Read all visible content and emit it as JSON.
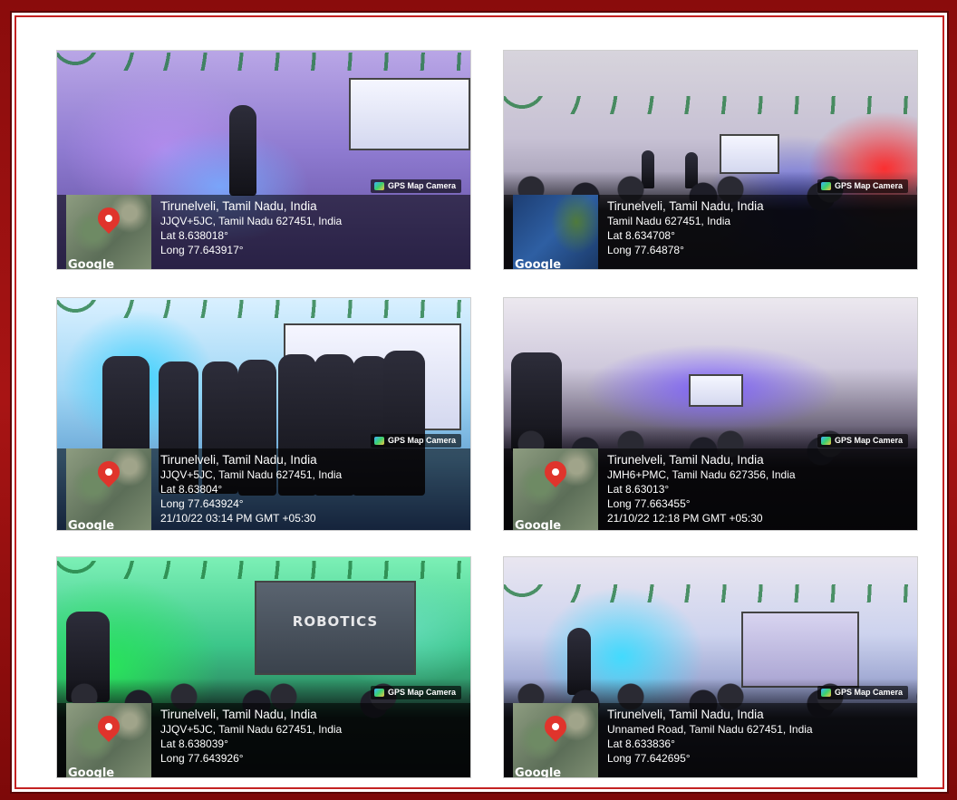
{
  "badge_label": "GPS Map Camera",
  "google_label": "Google",
  "photos": [
    {
      "city": "Tirunelveli, Tamil Nadu, India",
      "address": "JJQV+5JC, Tamil Nadu 627451, India",
      "lat": "Lat 8.638018°",
      "long": "Long 77.643917°",
      "datetime": ""
    },
    {
      "city": "Tirunelveli, Tamil Nadu, India",
      "address": "Tamil Nadu 627451, India",
      "lat": "Lat 8.634708°",
      "long": "Long 77.64878°",
      "datetime": ""
    },
    {
      "city": "Tirunelveli, Tamil Nadu, India",
      "address": "JJQV+5JC, Tamil Nadu 627451, India",
      "lat": "Lat 8.63804°",
      "long": "Long 77.643924°",
      "datetime": "21/10/22 03:14 PM GMT +05:30"
    },
    {
      "city": "Tirunelveli, Tamil Nadu, India",
      "address": "JMH6+PMC, Tamil Nadu 627356, India",
      "lat": "Lat 8.63013°",
      "long": "Long 77.663455°",
      "datetime": "21/10/22 12:18 PM GMT +05:30"
    },
    {
      "city": "Tirunelveli, Tamil Nadu, India",
      "address": "JJQV+5JC, Tamil Nadu 627451, India",
      "lat": "Lat 8.638039°",
      "long": "Long 77.643926°",
      "datetime": "",
      "screen_text": "ROBOTICS"
    },
    {
      "city": "Tirunelveli, Tamil Nadu, India",
      "address": "Unnamed Road, Tamil Nadu 627451, India",
      "lat": "Lat 8.633836°",
      "long": "Long 77.642695°",
      "datetime": ""
    }
  ]
}
